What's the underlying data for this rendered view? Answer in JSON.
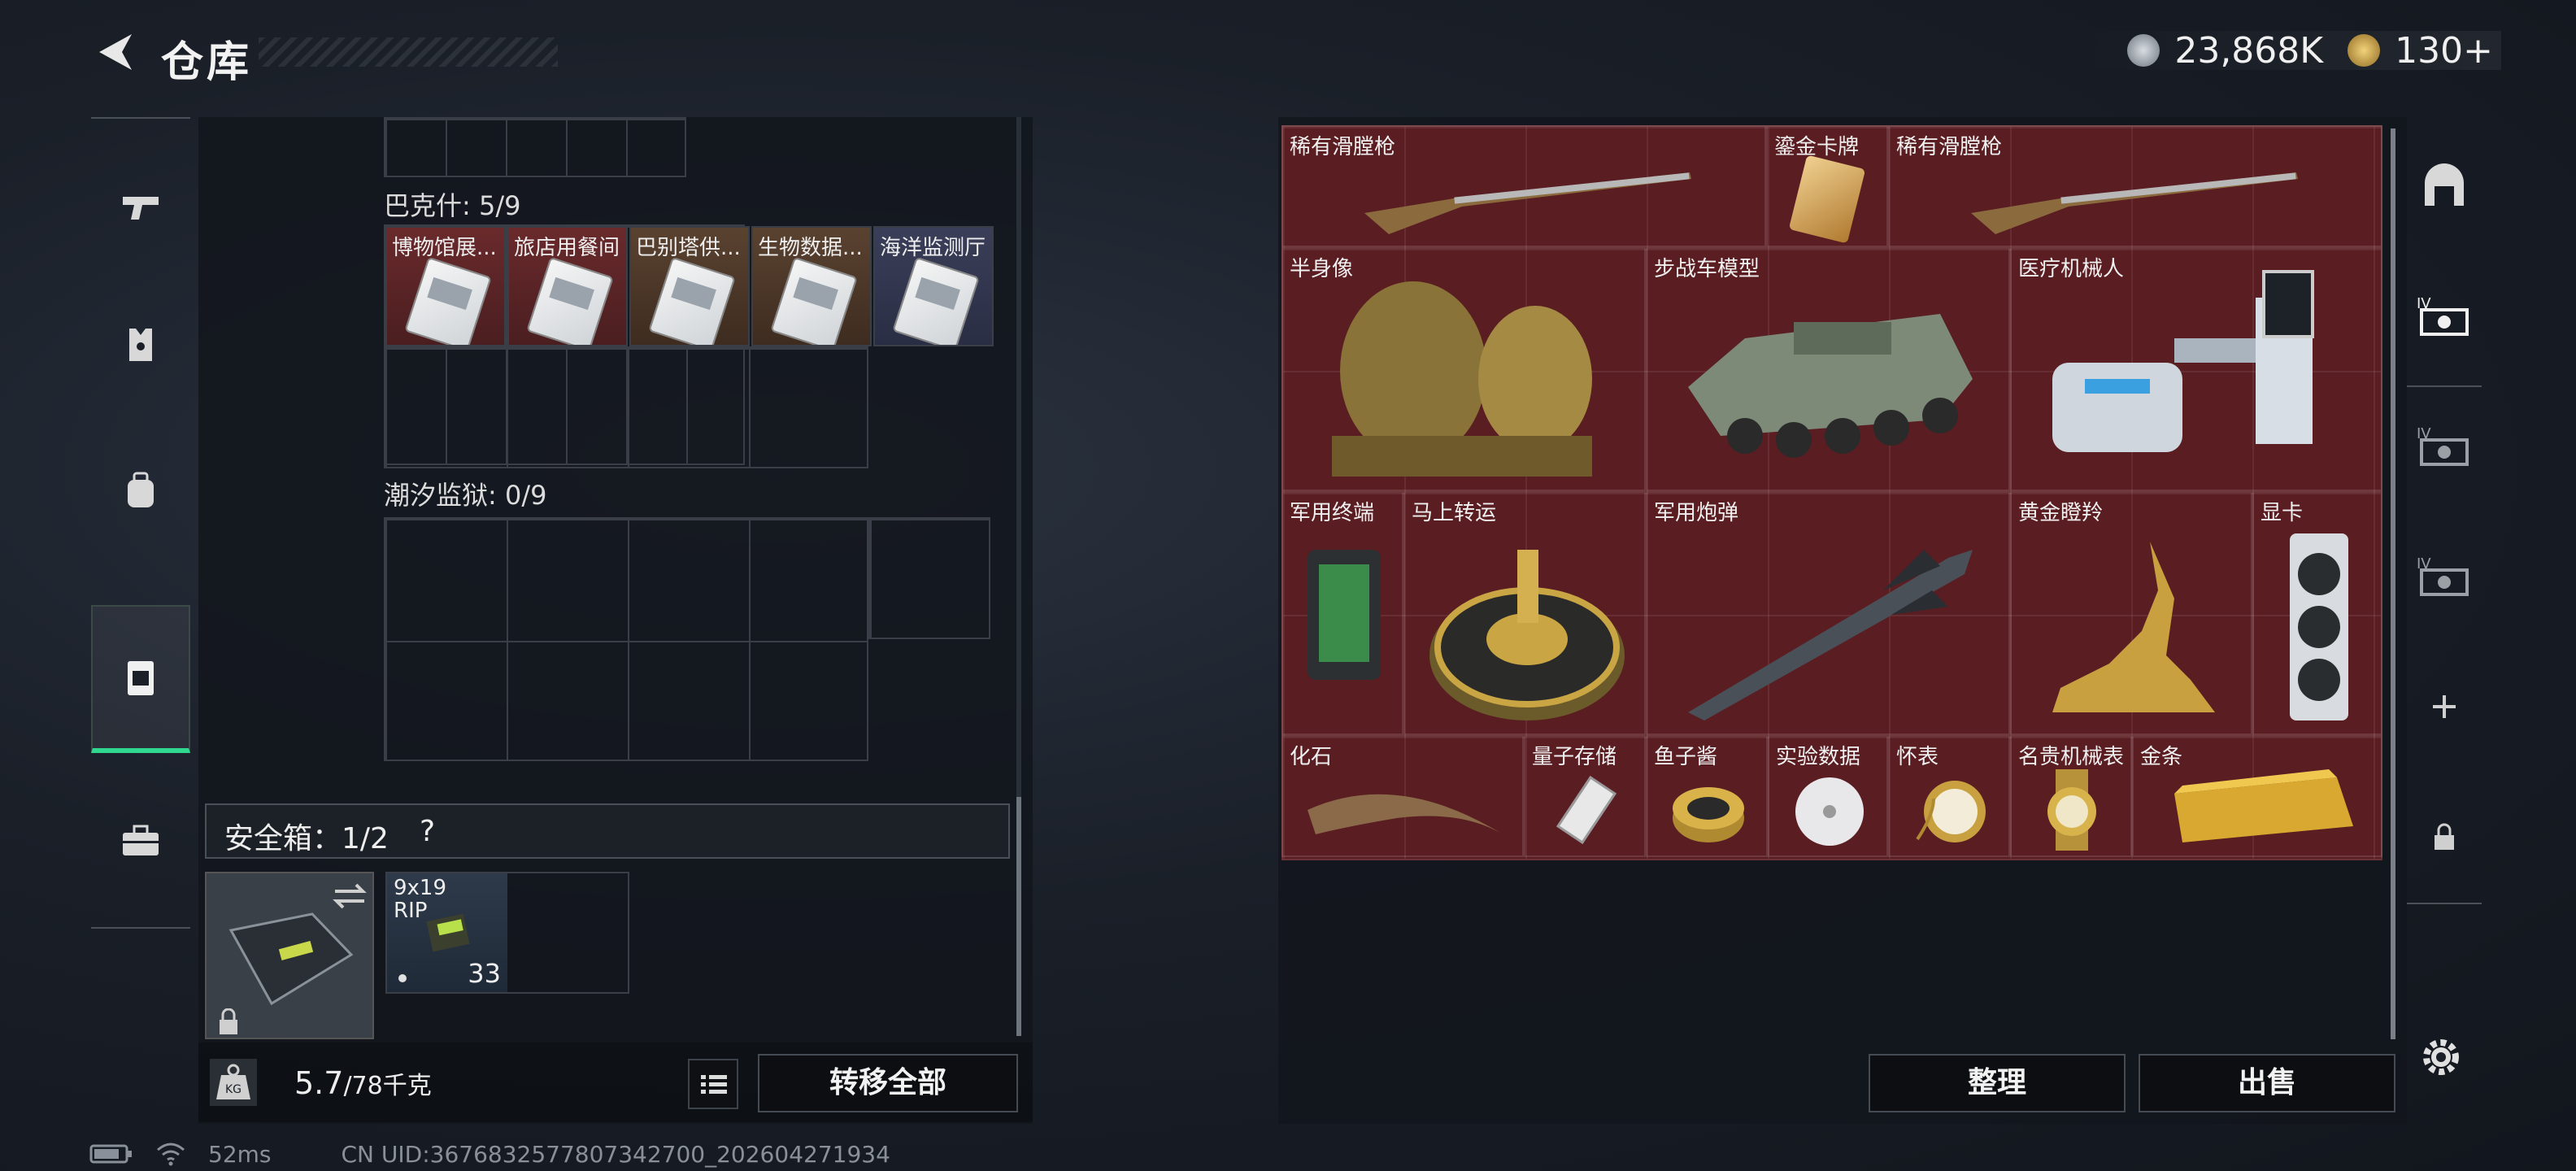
{
  "header": {
    "title": "仓库",
    "currency_a": "23,868K",
    "currency_b": "130+"
  },
  "left_nav": {
    "items": [
      "weapon",
      "equipment",
      "backpack",
      "container",
      "toolbox"
    ],
    "selected": "container"
  },
  "sections": [
    {
      "name": "巴克什: 5/9",
      "items": [
        "博物馆展...",
        "旅店用餐间",
        "巴别塔供...",
        "生物数据...",
        "海洋监测厅"
      ]
    },
    {
      "name": "潮汐监狱: 0/9",
      "items": []
    }
  ],
  "safe": {
    "label": "安全箱：1/2",
    "help": "?",
    "ammo_name": "9x19\nRIP",
    "ammo_count": "33"
  },
  "footer": {
    "weight": "5.7",
    "weight_max": "/78千克",
    "transfer_label": "转移全部"
  },
  "stash": {
    "items": [
      {
        "id": "musket1",
        "label": "稀有滑膛枪"
      },
      {
        "id": "goldcard",
        "label": "鎏金卡牌"
      },
      {
        "id": "musket2",
        "label": "稀有滑膛枪"
      },
      {
        "id": "bust",
        "label": "半身像"
      },
      {
        "id": "ifv",
        "label": "步战车模型"
      },
      {
        "id": "medrobot",
        "label": "医疗机械人"
      },
      {
        "id": "terminal",
        "label": "军用终端"
      },
      {
        "id": "fortune",
        "label": "马上转运"
      },
      {
        "id": "missile",
        "label": "军用炮弹"
      },
      {
        "id": "deer",
        "label": "黄金瞪羚"
      },
      {
        "id": "gpu",
        "label": "显卡"
      },
      {
        "id": "fossil",
        "label": "化石"
      },
      {
        "id": "quantum",
        "label": "量子存储"
      },
      {
        "id": "caviar",
        "label": "鱼子酱"
      },
      {
        "id": "disc",
        "label": "实验数据"
      },
      {
        "id": "pocketwatch",
        "label": "怀表"
      },
      {
        "id": "watch",
        "label": "名贵机械表"
      },
      {
        "id": "goldbar",
        "label": "金条"
      }
    ],
    "sort_label": "整理",
    "sell_label": "出售"
  },
  "status": {
    "ping": "52ms",
    "uid": "CN UID:3676832577807342700_202604271934"
  },
  "colors": {
    "accent": "#2fd88e",
    "stash_bg": "#5a1d22"
  }
}
